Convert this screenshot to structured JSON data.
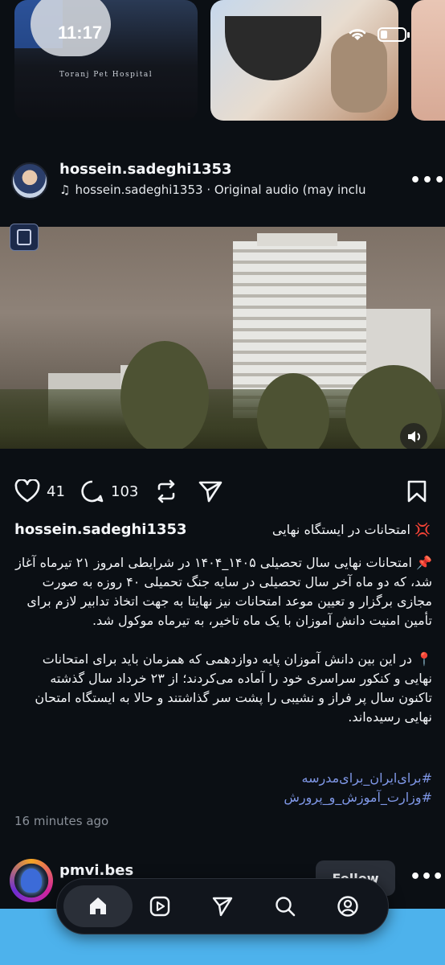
{
  "status_bar": {
    "time": "11:17"
  },
  "stories": {
    "first_caption": "Toranj Pet Hospital"
  },
  "post": {
    "username": "hossein.sadeghi1353",
    "audio_label": "hossein.sadeghi1353 · Original audio  (may inclu",
    "likes": "41",
    "comments": "103",
    "caption_title": "💢 امتحانات در ایستگاه نهایی",
    "caption_paragraphs": [
      "📌 امتحانات نهایی سال تحصیلی ۱۴۰۵_۱۴۰۴ در شرایطی امروز ۲۱ تیرماه آغاز شد، که دو ماه آخر سال تحصیلی در سایه جنگ تحمیلی ۴۰ روزه به صورت مجازی برگزار و تعیین موعد امتحانات نیز نهایتا به جهت اتخاذ تدابیر لازم برای تأمین امنیت دانش آموزان با یک ماه تاخیر، به تیرماه موکول شد.",
      "📍 در این بین دانش آموزان پایه دوازدهمی که همزمان باید برای امتحانات نهایی و کنکور سراسری خود را آماده می‌کردند؛ از ۲۳ خرداد سال گذشته تاکنون سال پر فراز و نشیبی را پشت سر گذاشتند و حالا به ایستگاه امتحان نهایی رسیده‌اند."
    ],
    "hashtags": [
      "#برای‌ایران_برای‌مدرسه",
      "#وزارت_آموزش_و_پرورش"
    ],
    "time_ago": "16 minutes ago"
  },
  "next_post": {
    "username": "pmvi.bes",
    "follow_label": "Follow"
  },
  "tabbar": {
    "items": [
      "home-icon",
      "reels-icon",
      "send-icon",
      "search-icon",
      "profile-icon"
    ],
    "active": "home"
  },
  "colors": {
    "background": "#0b0f14",
    "hashtag": "#7f97e6",
    "bottom_blue": "#4db2ec"
  }
}
